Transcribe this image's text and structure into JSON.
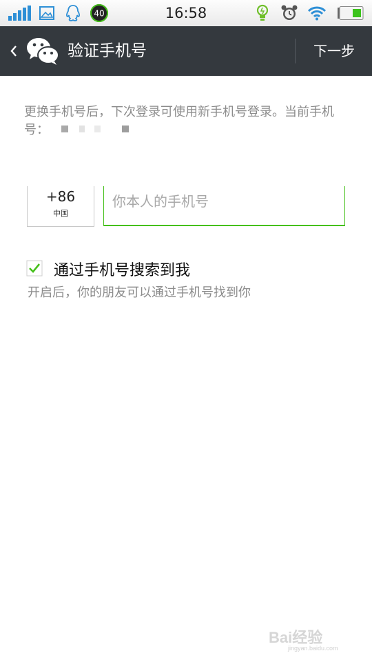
{
  "status_bar": {
    "time": "16:58",
    "badge": "40",
    "icons": [
      "signal-icon",
      "gallery-icon",
      "qq-icon",
      "counter-badge-icon",
      "bulb-icon",
      "alarm-icon",
      "wifi-icon",
      "battery-icon"
    ]
  },
  "header": {
    "title": "验证手机号",
    "next_label": "下一步"
  },
  "main": {
    "description": "更换手机号后，下次登录可使用新手机号登录。当前手机号：",
    "country_code": "+86",
    "country_name": "中国",
    "phone_placeholder": "你本人的手机号",
    "phone_value": "",
    "search_option": {
      "label": "通过手机号搜索到我",
      "checked": true,
      "hint": "开启后，你的朋友可以通过手机号找到你"
    }
  },
  "watermark": {
    "text": "Bai经验",
    "url": "jingyan.baidu.com"
  },
  "colors": {
    "titlebar": "#34393e",
    "accent_green": "#45c01a",
    "hint_gray": "#8c8c8c"
  }
}
